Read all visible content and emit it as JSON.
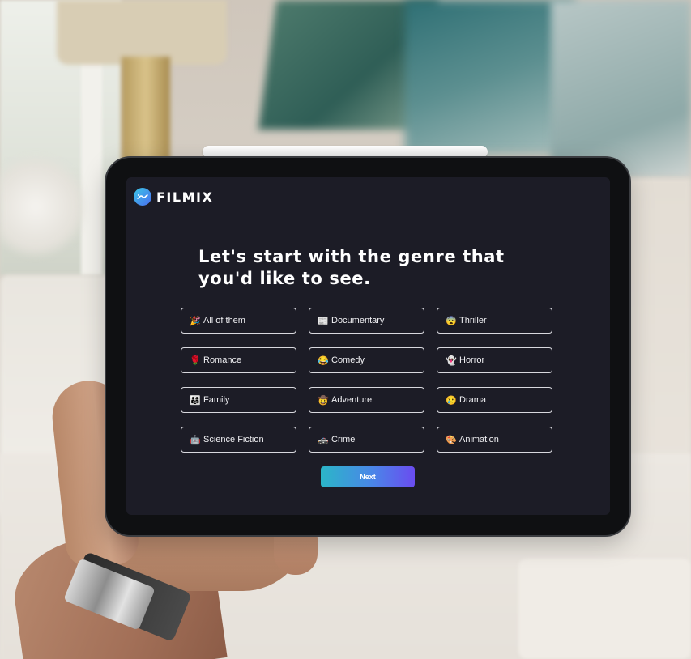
{
  "app": {
    "brand_name": "FILMIX"
  },
  "onboarding": {
    "headline_line1": "Let's start with the genre that",
    "headline_line2": "you'd like to see.",
    "genres": [
      {
        "label": "All of them",
        "icon": "🎉",
        "icon_name": "party-popper-icon"
      },
      {
        "label": "Documentary",
        "icon": "📰",
        "icon_name": "newspaper-icon"
      },
      {
        "label": "Thriller",
        "icon": "😨",
        "icon_name": "fearful-face-icon"
      },
      {
        "label": "Romance",
        "icon": "🌹",
        "icon_name": "rose-icon"
      },
      {
        "label": "Comedy",
        "icon": "😂",
        "icon_name": "laughing-face-icon"
      },
      {
        "label": "Horror",
        "icon": "👻",
        "icon_name": "ghost-icon"
      },
      {
        "label": "Family",
        "icon": "👨‍👩‍👧",
        "icon_name": "family-icon"
      },
      {
        "label": "Adventure",
        "icon": "🤠",
        "icon_name": "cowboy-hat-icon"
      },
      {
        "label": "Drama",
        "icon": "😢",
        "icon_name": "crying-face-icon"
      },
      {
        "label": "Science Fiction",
        "icon": "🤖",
        "icon_name": "robot-icon"
      },
      {
        "label": "Crime",
        "icon": "🚓",
        "icon_name": "police-car-icon"
      },
      {
        "label": "Animation",
        "icon": "🎨",
        "icon_name": "palette-icon"
      }
    ],
    "next_label": "Next"
  },
  "colors": {
    "screen_background": "#1c1c26",
    "button_gradient_start": "#2bb6c8",
    "button_gradient_end": "#6a4cf0",
    "brand_icon_start": "#3bc7e6",
    "brand_icon_end": "#4a6ef0"
  }
}
